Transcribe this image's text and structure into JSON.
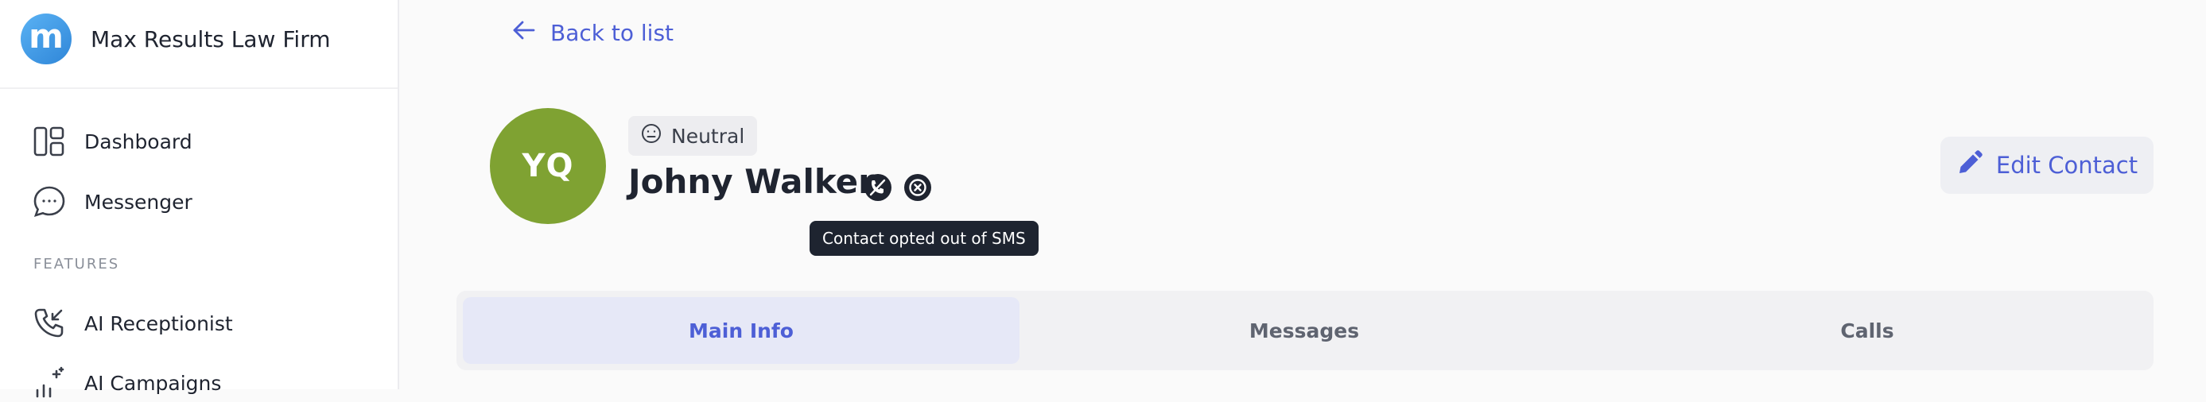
{
  "brand": {
    "logo_letter": "m",
    "name": "Max Results Law Firm"
  },
  "sidebar": {
    "items": [
      {
        "label": "Dashboard",
        "icon": "dashboard-icon"
      },
      {
        "label": "Messenger",
        "icon": "chat-bubble-icon"
      }
    ],
    "section_label": "FEATURES",
    "feature_items": [
      {
        "label": "AI Receptionist",
        "icon": "phone-incoming-icon"
      },
      {
        "label": "AI Campaigns",
        "icon": "sparkle-chart-icon"
      }
    ]
  },
  "header": {
    "back_label": "Back to list"
  },
  "contact": {
    "initials": "YQ",
    "avatar_color": "#7fa232",
    "sentiment": "Neutral",
    "name": "Johny Walker",
    "tooltip": "Contact opted out of SMS"
  },
  "actions": {
    "edit_label": "Edit Contact"
  },
  "tabs": [
    {
      "label": "Main Info",
      "active": true
    },
    {
      "label": "Messages",
      "active": false
    },
    {
      "label": "Calls",
      "active": false
    }
  ],
  "colors": {
    "accent": "#4d5fd6",
    "tooltip_bg": "#1e2430"
  }
}
